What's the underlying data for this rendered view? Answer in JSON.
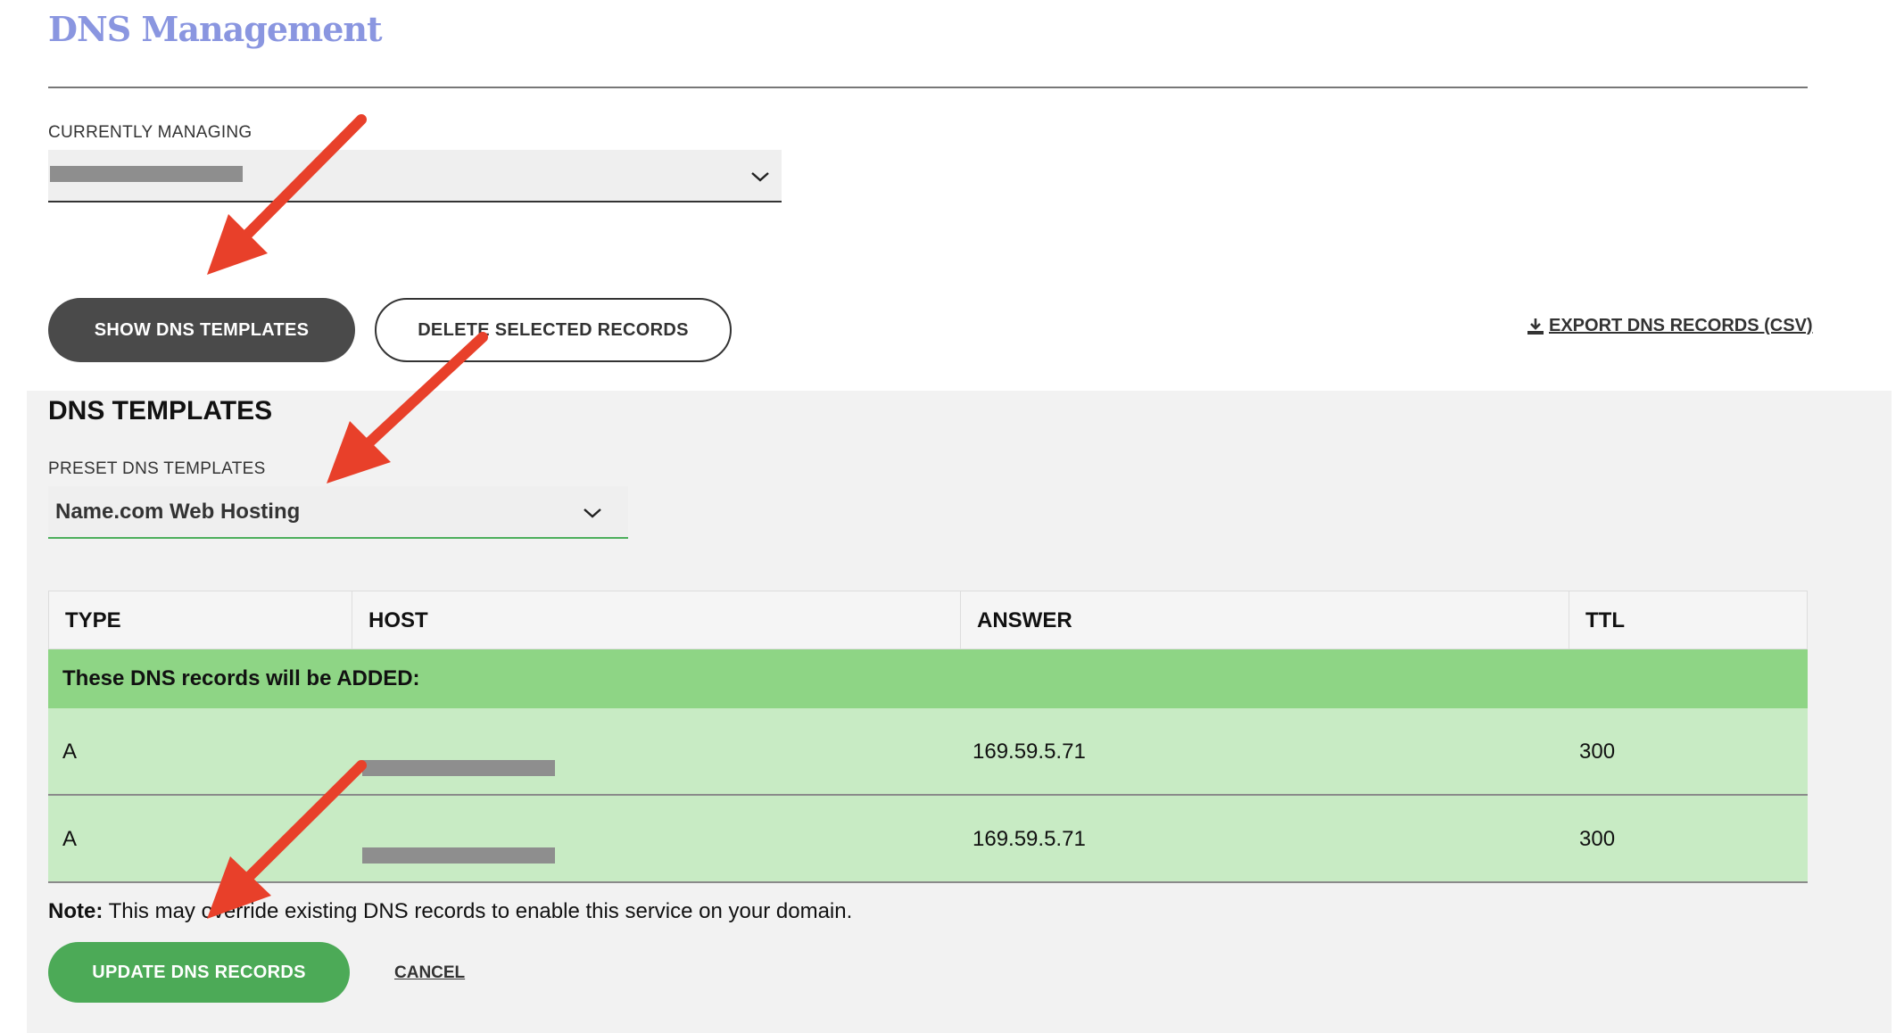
{
  "header": {
    "title": "DNS Management"
  },
  "managing": {
    "label": "CURRENTLY MANAGING"
  },
  "actions": {
    "show_templates": "SHOW DNS TEMPLATES",
    "delete_selected": "DELETE SELECTED RECORDS",
    "export": "EXPORT DNS RECORDS (CSV)"
  },
  "templates": {
    "heading": "DNS TEMPLATES",
    "preset_label": "PRESET DNS TEMPLATES",
    "preset_value": "Name.com Web Hosting"
  },
  "table": {
    "columns": [
      "TYPE",
      "HOST",
      "ANSWER",
      "TTL"
    ],
    "added_label": "These DNS records will be ADDED:",
    "rows": [
      {
        "type": "A",
        "answer": "169.59.5.71",
        "ttl": "300"
      },
      {
        "type": "A",
        "answer": "169.59.5.71",
        "ttl": "300"
      }
    ]
  },
  "note": {
    "bold": "Note:",
    "text": " This may override existing DNS records to enable this service on your domain."
  },
  "footer": {
    "update": "UPDATE DNS RECORDS",
    "cancel": "CANCEL"
  },
  "colors": {
    "title": "#8a96e0",
    "annotation_arrow": "#e8402a",
    "update_button": "#4caa57",
    "added_header": "#8ed585",
    "record_row": "#c8ebc4"
  }
}
